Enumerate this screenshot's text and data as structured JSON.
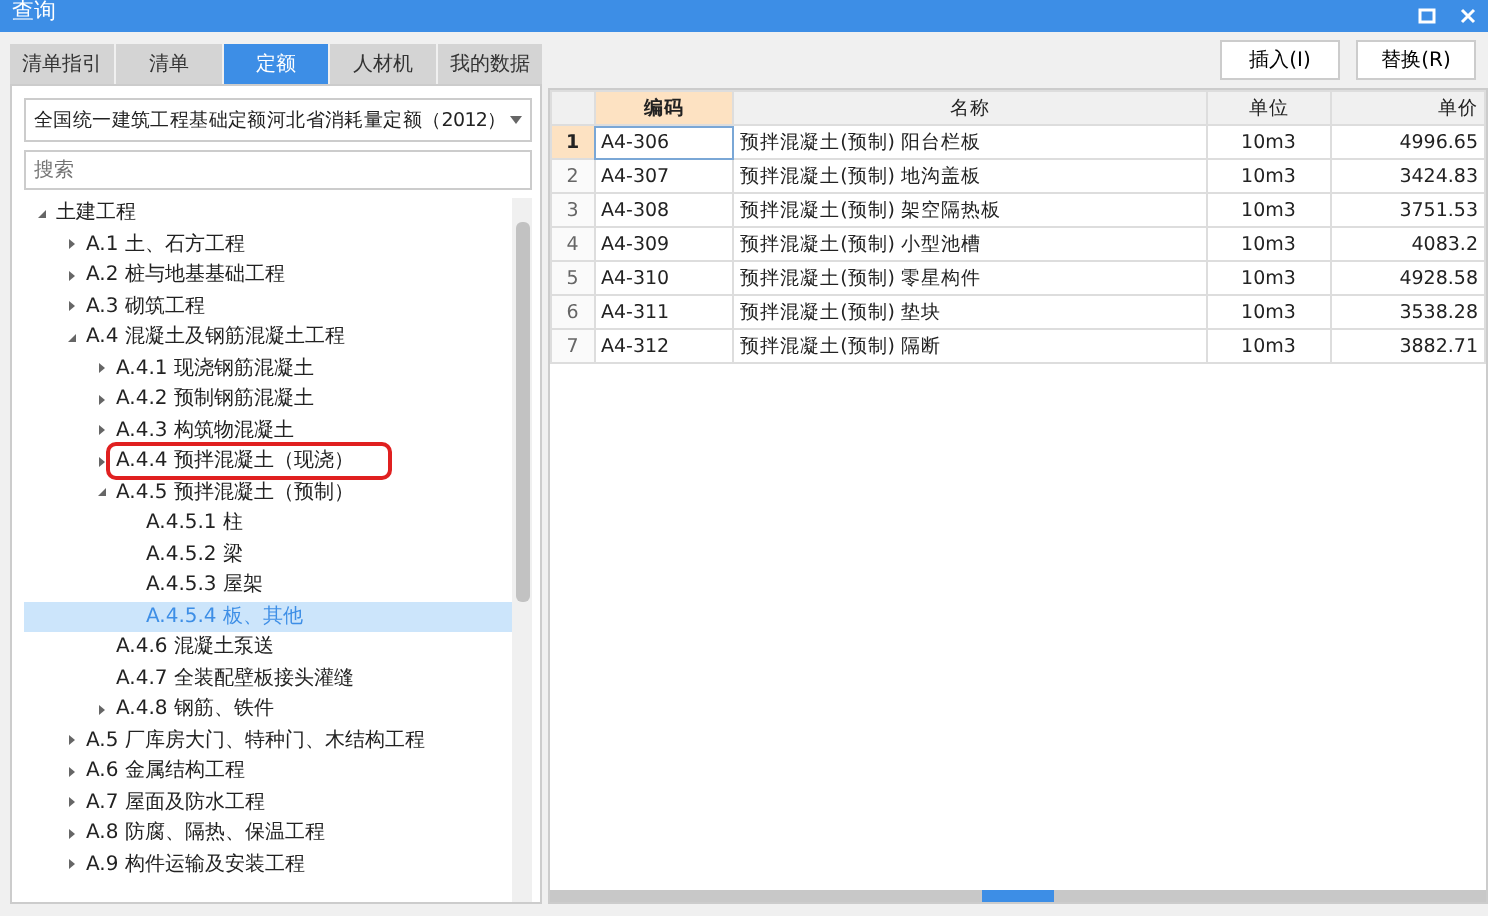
{
  "window": {
    "title": "查询"
  },
  "tabs": [
    {
      "label": "清单指引",
      "selected": false
    },
    {
      "label": "清单",
      "selected": false
    },
    {
      "label": "定额",
      "selected": true
    },
    {
      "label": "人材机",
      "selected": false
    },
    {
      "label": "我的数据",
      "selected": false
    }
  ],
  "library_select": {
    "value": "全国统一建筑工程基础定额河北省消耗量定额（2012）"
  },
  "search": {
    "placeholder": "搜索"
  },
  "tree": [
    {
      "label": "土建工程",
      "expanded": true,
      "selected": false,
      "highlighted": false,
      "children": [
        {
          "label": "A.1 土、石方工程",
          "expanded": false,
          "selected": false,
          "highlighted": false
        },
        {
          "label": "A.2 桩与地基基础工程",
          "expanded": false,
          "selected": false,
          "highlighted": false
        },
        {
          "label": "A.3 砌筑工程",
          "expanded": false,
          "selected": false,
          "highlighted": false
        },
        {
          "label": "A.4 混凝土及钢筋混凝土工程",
          "expanded": true,
          "selected": false,
          "highlighted": false,
          "children": [
            {
              "label": "A.4.1 现浇钢筋混凝土",
              "expanded": false,
              "selected": false,
              "highlighted": false
            },
            {
              "label": "A.4.2 预制钢筋混凝土",
              "expanded": false,
              "selected": false,
              "highlighted": false
            },
            {
              "label": "A.4.3 构筑物混凝土",
              "expanded": false,
              "selected": false,
              "highlighted": false
            },
            {
              "label": "A.4.4 预拌混凝土（现浇）",
              "expanded": false,
              "selected": false,
              "highlighted": true
            },
            {
              "label": "A.4.5 预拌混凝土（预制）",
              "expanded": true,
              "selected": false,
              "highlighted": false,
              "children": [
                {
                  "label": "A.4.5.1 柱",
                  "selected": false,
                  "highlighted": false
                },
                {
                  "label": "A.4.5.2 梁",
                  "selected": false,
                  "highlighted": false
                },
                {
                  "label": "A.4.5.3 屋架",
                  "selected": false,
                  "highlighted": false
                },
                {
                  "label": "A.4.5.4 板、其他",
                  "selected": true,
                  "highlighted": false
                }
              ]
            },
            {
              "label": "A.4.6 混凝土泵送",
              "selected": false,
              "highlighted": false
            },
            {
              "label": "A.4.7 全装配壁板接头灌缝",
              "selected": false,
              "highlighted": false
            },
            {
              "label": "A.4.8 钢筋、铁件",
              "expanded": false,
              "selected": false,
              "highlighted": false
            }
          ]
        },
        {
          "label": "A.5 厂库房大门、特种门、木结构工程",
          "expanded": false,
          "selected": false,
          "highlighted": false
        },
        {
          "label": "A.6 金属结构工程",
          "expanded": false,
          "selected": false,
          "highlighted": false
        },
        {
          "label": "A.7 屋面及防水工程",
          "expanded": false,
          "selected": false,
          "highlighted": false
        },
        {
          "label": "A.8 防腐、隔热、保温工程",
          "expanded": false,
          "selected": false,
          "highlighted": false
        },
        {
          "label": "A.9 构件运输及安装工程",
          "expanded": false,
          "selected": false,
          "highlighted": false
        }
      ]
    }
  ],
  "buttons": [
    {
      "label": "插入(I)"
    },
    {
      "label": "替换(R)"
    }
  ],
  "table": {
    "columns": [
      "编码",
      "名称",
      "单位",
      "单价"
    ],
    "rows": [
      {
        "index": "1",
        "selected": true,
        "cells": [
          "A4-306",
          "预拌混凝土(预制) 阳台栏板",
          "10m3",
          "4996.65"
        ]
      },
      {
        "index": "2",
        "selected": false,
        "cells": [
          "A4-307",
          "预拌混凝土(预制) 地沟盖板",
          "10m3",
          "3424.83"
        ]
      },
      {
        "index": "3",
        "selected": false,
        "cells": [
          "A4-308",
          "预拌混凝土(预制) 架空隔热板",
          "10m3",
          "3751.53"
        ]
      },
      {
        "index": "4",
        "selected": false,
        "cells": [
          "A4-309",
          "预拌混凝土(预制) 小型池槽",
          "10m3",
          "4083.2"
        ]
      },
      {
        "index": "5",
        "selected": false,
        "cells": [
          "A4-310",
          "预拌混凝土(预制) 零星构件",
          "10m3",
          "4928.58"
        ]
      },
      {
        "index": "6",
        "selected": false,
        "cells": [
          "A4-311",
          "预拌混凝土(预制) 垫块",
          "10m3",
          "3538.28"
        ]
      },
      {
        "index": "7",
        "selected": false,
        "cells": [
          "A4-312",
          "预拌混凝土(预制) 隔断",
          "10m3",
          "3882.71"
        ]
      }
    ]
  }
}
